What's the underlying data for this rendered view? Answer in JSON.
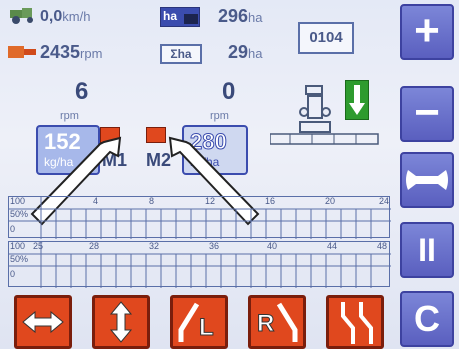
{
  "header": {
    "speed_value": "0,0",
    "speed_unit": "km/h",
    "rpm_value": "2435",
    "rpm_unit": "rpm",
    "ha_label": "ha",
    "ha_value": "296",
    "ha_unit": "ha",
    "sum_ha_label": "Σha",
    "sum_ha_value": "29",
    "sum_ha_unit": "ha",
    "code": "0104"
  },
  "motors": {
    "m1_rpm_value": "6",
    "m1_rpm_unit": "rpm",
    "m2_rpm_value": "0",
    "m2_rpm_unit": "rpm",
    "m1_rate": "152",
    "m1_rate_unit": "kg/ha",
    "m1_label": "M1",
    "m2_rate": "280",
    "m2_rate_unit": "kg/ha",
    "m2_label": "M2"
  },
  "grid": {
    "row1_ticks": [
      "100",
      "4",
      "8",
      "12",
      "16",
      "20",
      "24"
    ],
    "row2_ticks": [
      "100",
      "25",
      "28",
      "32",
      "36",
      "40",
      "44",
      "48"
    ],
    "percent_50": "50%",
    "zero": "0"
  },
  "right_buttons": {
    "plus": "+",
    "minus": "−",
    "pause": "II",
    "clear": "C"
  },
  "bottom_buttons": {
    "left_label": "L",
    "right_label": "R"
  },
  "colors": {
    "accent_blue": "#5a5fbf",
    "button_red": "#e0481e",
    "arrow_green": "#2e9b2e"
  }
}
